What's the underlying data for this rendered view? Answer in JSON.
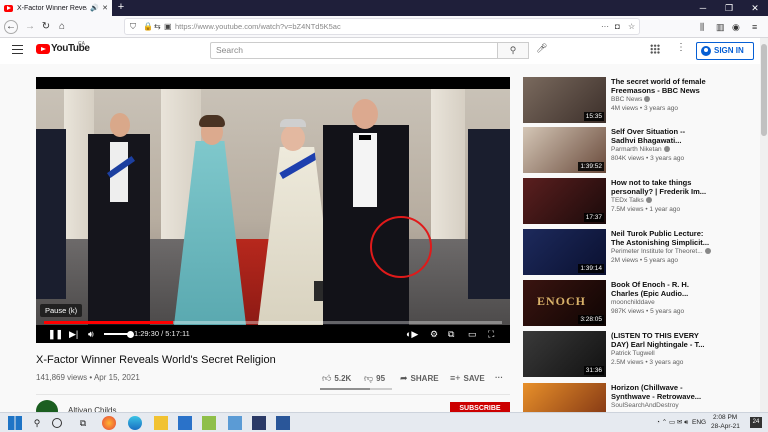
{
  "browser": {
    "tab_title": "X-Factor Winner Reveals W",
    "url": "https://www.youtube.com/watch?v=bZ4NTd5K5ac",
    "new_tab": "+"
  },
  "youtube": {
    "logo_text": "YouTube",
    "country": "CA",
    "search_placeholder": "Search",
    "sign_in": "SIGN IN"
  },
  "player": {
    "tooltip": "Pause (k)",
    "time": "1:29:30 / 5:17:11",
    "progress": 0.282
  },
  "video": {
    "title": "X-Factor Winner Reveals World's Secret Religion",
    "meta": "141,869 views • Apr 15, 2021",
    "likes": "5.2K",
    "dislikes": "95",
    "share": "SHARE",
    "save": "SAVE",
    "channel": "Altiyan Childs",
    "subscribe": "SUBSCRIBE"
  },
  "related": [
    {
      "title": "The secret world of female Freemasons - BBC News",
      "channel": "BBC News",
      "meta": "4M views • 3 years ago",
      "duration": "15:35",
      "thumb": [
        "#7a6a5e",
        "#3c2f2a"
      ]
    },
    {
      "title": "Self Over Situation -- Sadhvi Bhagawati...",
      "channel": "Parmarth Niketan",
      "meta": "804K views • 3 years ago",
      "duration": "1:39:52",
      "thumb": [
        "#d4c6b6",
        "#6a4b3c"
      ]
    },
    {
      "title": "How not to take things personally? | Frederik Im...",
      "channel": "TEDx Talks",
      "meta": "7.5M views • 1 year ago",
      "duration": "17:37",
      "thumb": [
        "#5b1f1f",
        "#1a0a0a"
      ]
    },
    {
      "title": "Neil Turok Public Lecture: The Astonishing Simplicit...",
      "channel": "Perimeter Institute for Theoret...",
      "meta": "2M views • 5 years ago",
      "duration": "1:39:14",
      "thumb": [
        "#1d2a5c",
        "#0a1030"
      ]
    },
    {
      "title": "Book Of Enoch - R. H. Charles (Epic Audio...",
      "channel": "moonchilddave",
      "meta": "987K views • 5 years ago",
      "duration": "3:28:05",
      "thumb": [
        "#3a1410",
        "#0f0503"
      ],
      "thumb_text": "ENOCH"
    },
    {
      "title": "(LISTEN TO THIS EVERY DAY) Earl Nightingale - T...",
      "channel": "Patrick Tugwell",
      "meta": "2.5M views • 3 years ago",
      "duration": "31:36",
      "thumb": [
        "#3a3a3a",
        "#111111"
      ]
    },
    {
      "title": "Horizon (Chillwave - Synthwave - Retrowave...",
      "channel": "SoulSearchAndDestroy",
      "meta": "",
      "duration": "",
      "thumb": [
        "#e8902a",
        "#7a2f12"
      ]
    }
  ],
  "taskbar": {
    "language": "ENG",
    "time": "2:08 PM",
    "date": "28-Apr-21",
    "notifications": "24"
  },
  "colors": {
    "youtube_red": "#ff0000",
    "link_blue": "#065fd4",
    "annotation_red": "#e01a1a"
  }
}
